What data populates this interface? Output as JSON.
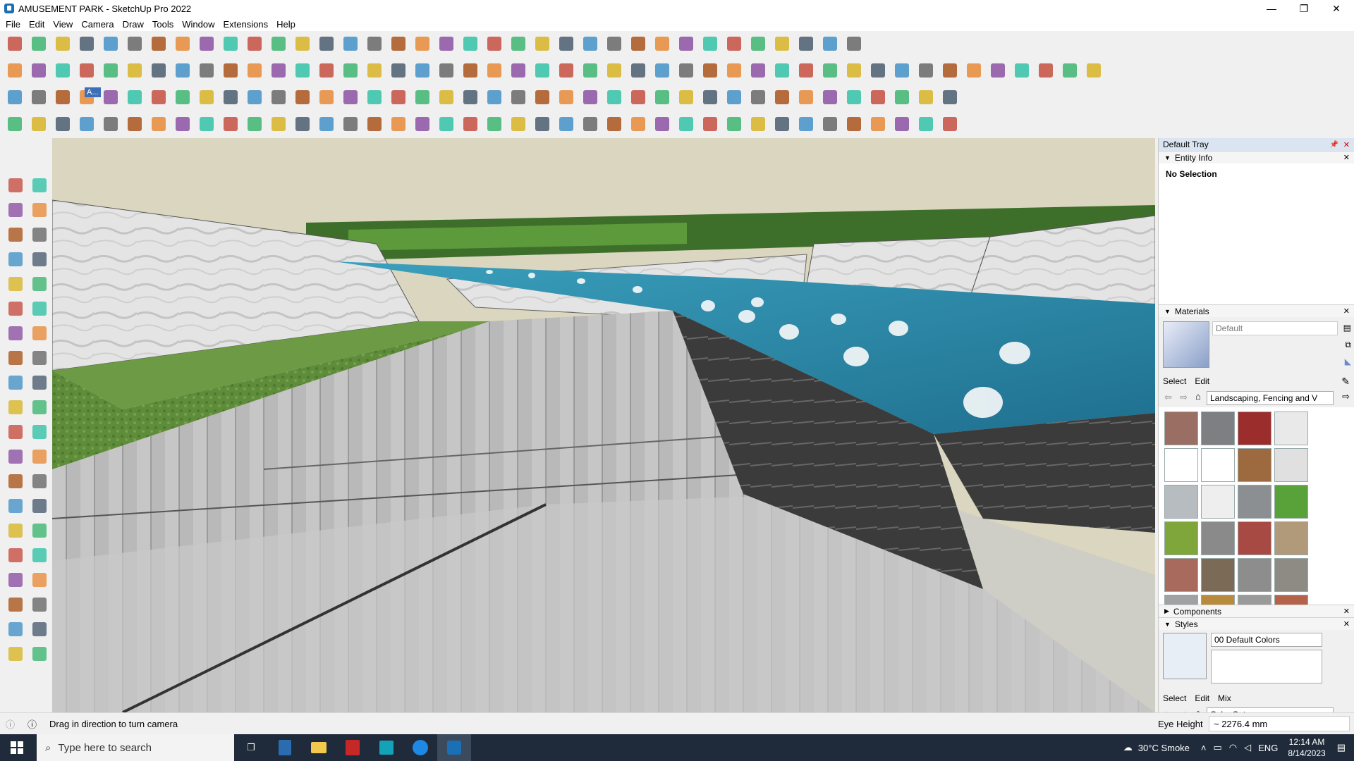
{
  "window": {
    "title": "AMUSEMENT PARK - SketchUp Pro 2022",
    "minimize_glyph": "—",
    "restore_glyph": "❐",
    "close_glyph": "✕"
  },
  "menu": [
    "File",
    "Edit",
    "View",
    "Camera",
    "Draw",
    "Tools",
    "Window",
    "Extensions",
    "Help"
  ],
  "toolbar_tag": "A...",
  "tray": {
    "title": "Default Tray",
    "entity_info": {
      "label": "Entity Info",
      "value": "No Selection"
    },
    "materials": {
      "label": "Materials",
      "current": "Default",
      "tabs": [
        "Select",
        "Edit"
      ],
      "collection": "Landscaping, Fencing and V"
    },
    "components": {
      "label": "Components"
    },
    "styles": {
      "label": "Styles",
      "current": "00  Default Colors",
      "tabs": [
        "Select",
        "Edit",
        "Mix"
      ],
      "collection": "Color Sets"
    }
  },
  "status": {
    "hint": "Drag in direction to turn camera",
    "measure_label": "Eye Height",
    "measure_value": "~ 2276.4 mm"
  },
  "taskbar": {
    "search_placeholder": "Type here to search",
    "weather": "30°C  Smoke",
    "language": "ENG",
    "time": "12:14 AM",
    "date": "8/14/2023"
  },
  "colors": {
    "sky": "#dad6bf",
    "water": "#2f86a6",
    "grass": "#5f8c3a",
    "stone": "#b9b9b9",
    "taskbar": "#1f2b3a",
    "tray_header": "#dbe5f1"
  },
  "swatch_colors": [
    "#9a6e62",
    "#7d7f82",
    "#9b2d2d",
    "#e9e9e9",
    "#ffffff",
    "#ffffff",
    "#9c6a3e",
    "#e0e0e0",
    "#b7bcc0",
    "#eeeeee",
    "#8c8f91",
    "#59a23a",
    "#7ea63a",
    "#8a8a8a",
    "#a84a44",
    "#b19a7a",
    "#a86a5c",
    "#7b6a56",
    "#8d8d8d",
    "#8e8a84",
    "#9fa1a3",
    "#b88a3c",
    "#9a9a9a",
    "#b4634a"
  ]
}
